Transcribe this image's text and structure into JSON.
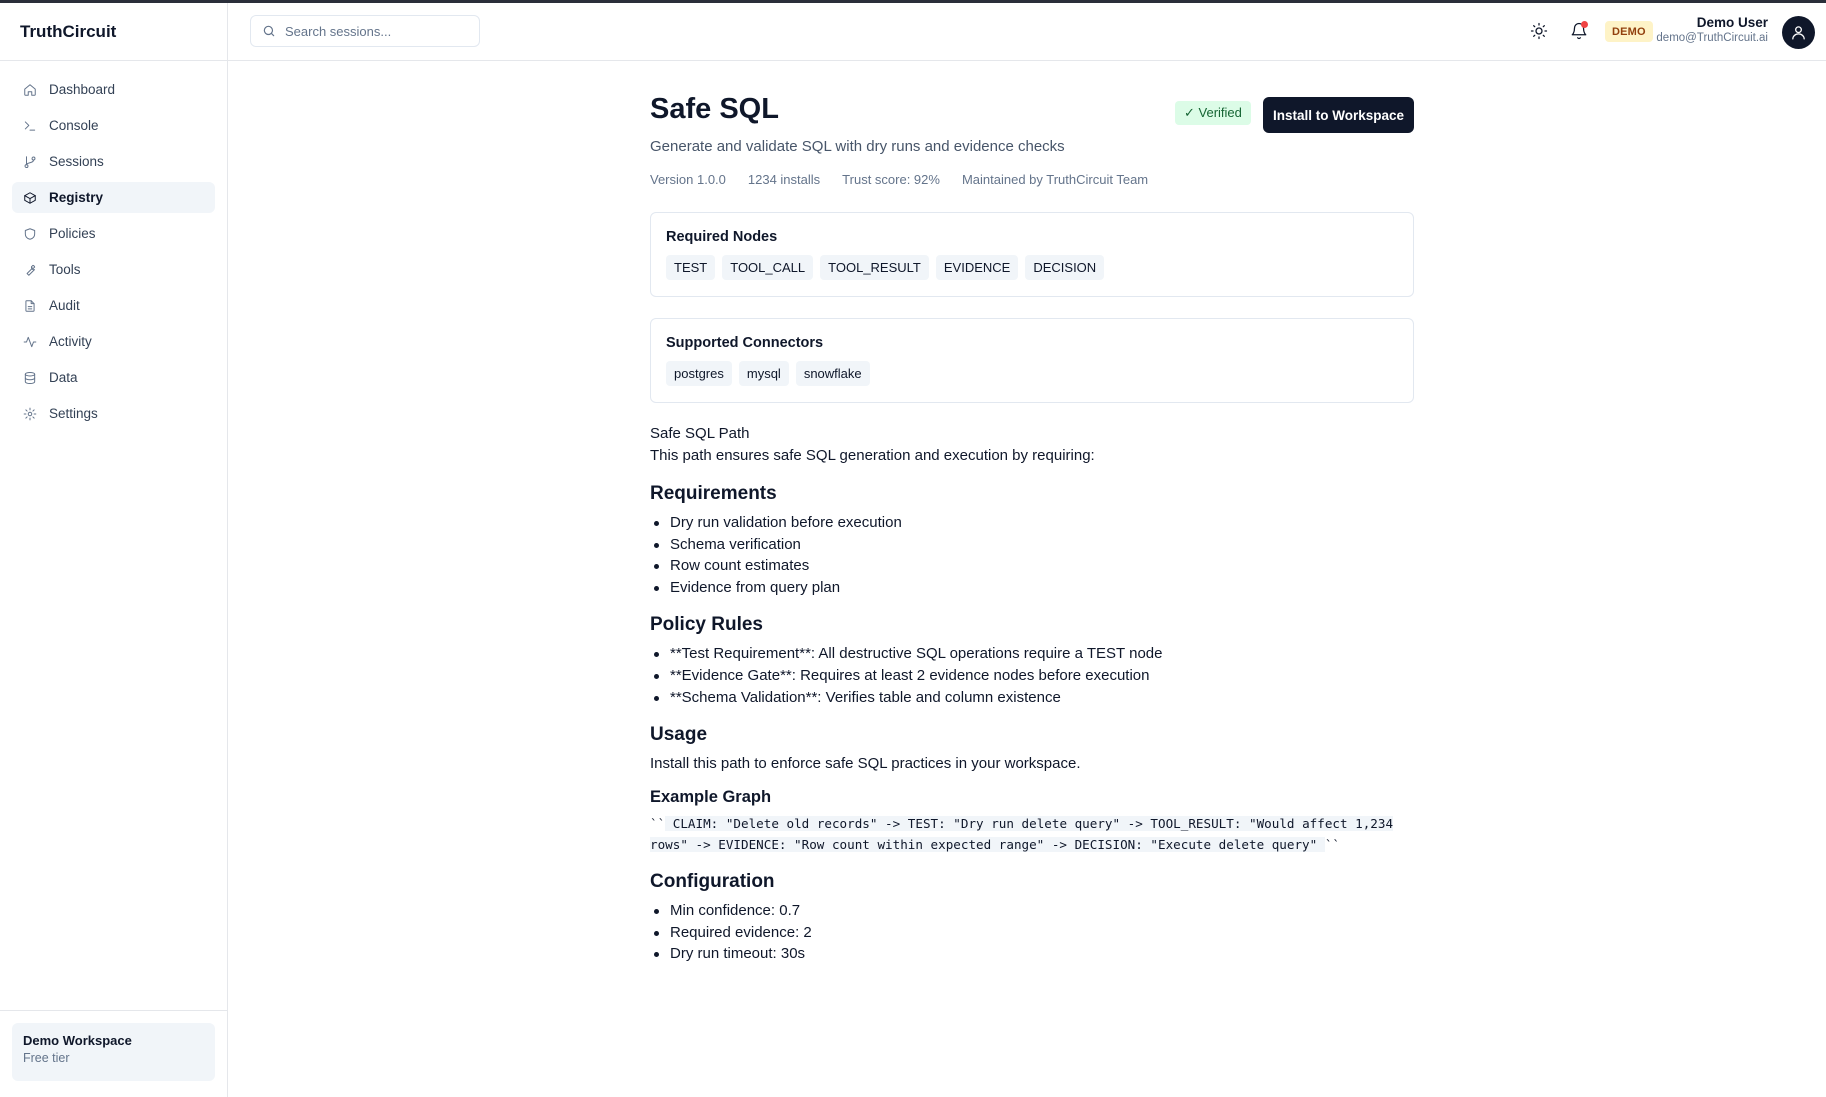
{
  "app": {
    "name": "TruthCircuit"
  },
  "sidebar": {
    "items": [
      {
        "label": "Dashboard",
        "icon": "home-icon"
      },
      {
        "label": "Console",
        "icon": "terminal-icon"
      },
      {
        "label": "Sessions",
        "icon": "git-branch-icon"
      },
      {
        "label": "Registry",
        "icon": "package-icon",
        "active": true
      },
      {
        "label": "Policies",
        "icon": "shield-icon"
      },
      {
        "label": "Tools",
        "icon": "wrench-icon"
      },
      {
        "label": "Audit",
        "icon": "file-text-icon"
      },
      {
        "label": "Activity",
        "icon": "activity-icon"
      },
      {
        "label": "Data",
        "icon": "database-icon"
      },
      {
        "label": "Settings",
        "icon": "gear-icon"
      }
    ],
    "workspace": {
      "name": "Demo Workspace",
      "tier": "Free tier"
    }
  },
  "header": {
    "search_placeholder": "Search sessions...",
    "demo_badge": "DEMO",
    "user": {
      "name": "Demo User",
      "email": "demo@TruthCircuit.ai"
    }
  },
  "package": {
    "title": "Safe SQL",
    "verified_label": "✓ Verified",
    "install_label": "Install to Workspace",
    "subtitle": "Generate and validate SQL with dry runs and evidence checks",
    "meta": {
      "version": "Version 1.0.0",
      "installs": "1234 installs",
      "trust": "Trust score: 92%",
      "maintainer": "Maintained by TruthCircuit Team"
    },
    "required_nodes": {
      "title": "Required Nodes",
      "items": [
        "TEST",
        "TOOL_CALL",
        "TOOL_RESULT",
        "EVIDENCE",
        "DECISION"
      ]
    },
    "connectors": {
      "title": "Supported Connectors",
      "items": [
        "postgres",
        "mysql",
        "snowflake"
      ]
    }
  },
  "doc": {
    "intro_title": "Safe SQL Path",
    "intro_text": "This path ensures safe SQL generation and execution by requiring:",
    "requirements_heading": "Requirements",
    "requirements": [
      "Dry run validation before execution",
      "Schema verification",
      "Row count estimates",
      "Evidence from query plan"
    ],
    "policy_heading": "Policy Rules",
    "policies": [
      "**Test Requirement**: All destructive SQL operations require a TEST node",
      "**Evidence Gate**: Requires at least 2 evidence nodes before execution",
      "**Schema Validation**: Verifies table and column existence"
    ],
    "usage_heading": "Usage",
    "usage_text": "Install this path to enforce safe SQL practices in your workspace.",
    "example_heading": "Example Graph",
    "code_open": "``",
    "code_line1": " CLAIM: \"Delete old records\" -> TEST: \"Dry run delete query\" -> TOOL_RESULT: \"Would affect 1,234",
    "code_line2": "rows\" -> EVIDENCE: \"Row count within expected range\" -> DECISION: \"Execute delete query\" ",
    "code_close": "``",
    "config_heading": "Configuration",
    "config": [
      "Min confidence: 0.7",
      "Required evidence: 2",
      "Dry run timeout: 30s"
    ]
  }
}
